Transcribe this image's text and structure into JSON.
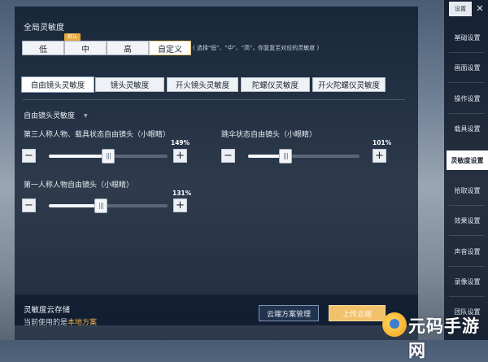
{
  "global": {
    "title": "全局灵敏度",
    "options": [
      "低",
      "中",
      "高",
      "自定义"
    ],
    "selected": "自定义",
    "default_badge": "默认",
    "hint": "( 选择\"低\"、\"中\"、\"高\"，你复复至对应的灵敏度 )"
  },
  "tabs": [
    "自由镜头灵敏度",
    "镜头灵敏度",
    "开火镜头灵敏度",
    "陀螺仪灵敏度",
    "开火陀螺仪灵敏度"
  ],
  "active_tab": "自由镜头灵敏度",
  "section": {
    "title": "自由镜头灵敏度"
  },
  "sliders": [
    {
      "label": "第三人称人物、载具状态自由镜头（小眼睛）",
      "value_text": "149%",
      "value": 149,
      "max": 300
    },
    {
      "label": "跳伞状态自由镜头（小眼睛）",
      "value_text": "101%",
      "value": 101,
      "max": 300
    },
    {
      "label": "第一人称人物自由镜头（小眼睛）",
      "value_text": "131%",
      "value": 131,
      "max": 300
    }
  ],
  "cloud": {
    "title": "灵敏度云存储",
    "current_prefix": "当前使用的是",
    "current_plan": "本地方案",
    "manage_button": "云端方案管理",
    "upload_button": "上传云端"
  },
  "sidebar": {
    "top_button": "设置",
    "items": [
      "基础设置",
      "画面设置",
      "操作设置",
      "载具设置",
      "灵敏度设置",
      "拾取设置",
      "效果设置",
      "声音设置",
      "录像设置",
      "团队设置"
    ],
    "active": "灵敏度设置"
  },
  "watermark": {
    "text": "元码手游网"
  },
  "colors": {
    "accent": "#e9a93b",
    "highlight": "#f0b04a",
    "panel": "#061224"
  }
}
